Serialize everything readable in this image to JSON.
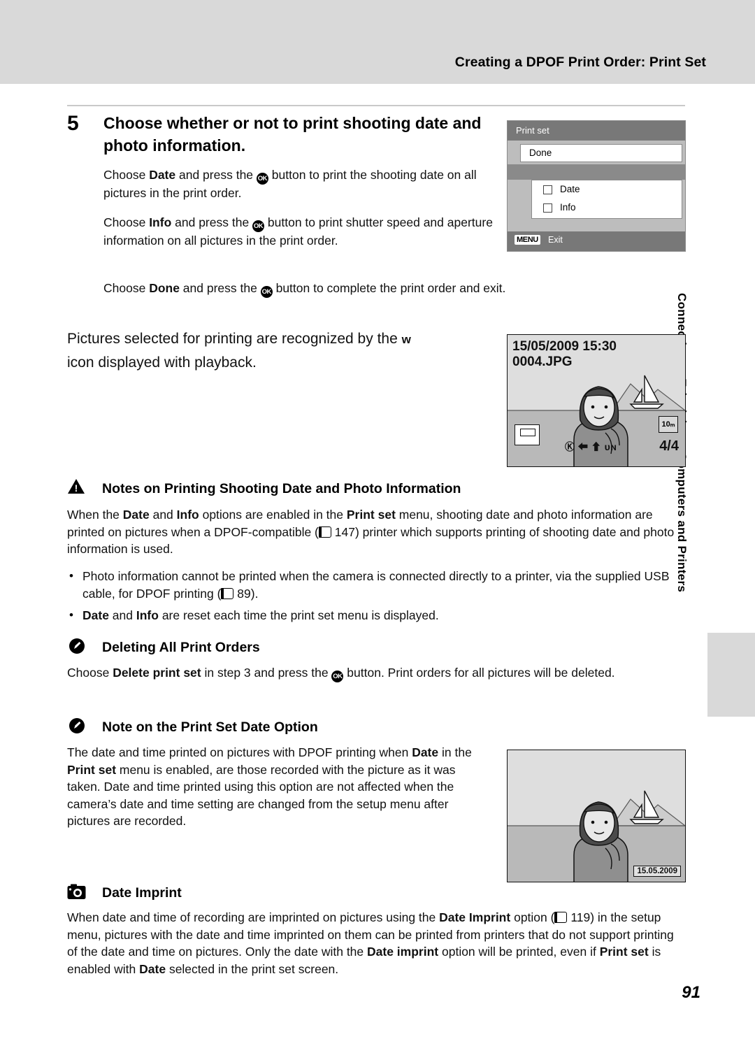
{
  "header": {
    "title": "Creating a DPOF Print Order: Print Set"
  },
  "side_tab": {
    "text": "Connecting to Televisions, Computers and Printers"
  },
  "step": {
    "number": "5",
    "heading": "Choose whether or not to print shooting date and photo information.",
    "p1_a": "Choose ",
    "p1_b": "Date",
    "p1_c": " and press the ",
    "p1_d": " button to print the shooting date on all pictures in the print order.",
    "p2_a": "Choose ",
    "p2_b": "Info",
    "p2_c": " and press the ",
    "p2_d": " button to print shutter speed and aperture information on all pictures in the print order.",
    "p3_a": "Choose ",
    "p3_b": "Done",
    "p3_c": " and press the ",
    "p3_d": " button to complete the print order and exit."
  },
  "recognize": {
    "line1": "Pictures selected for printing are recognized by the",
    "icon": "w",
    "line2": "icon displayed with playback."
  },
  "print_set_screen": {
    "title": "Print set",
    "done": "Done",
    "options": [
      "Date",
      "Info"
    ],
    "menu_badge": "MENU",
    "exit": "Exit"
  },
  "playback_screen": {
    "date": "15/05/2009 15:30",
    "file": "0004.JPG",
    "bottom_icons": "Ⓚ ⬅ ⬆ ᴜɴ",
    "frame_count": "4/",
    "frame_total": "4",
    "image_size": "10ₘ"
  },
  "notes_printing": {
    "title": "Notes on Printing Shooting Date and Photo Information",
    "p1_1": "When the ",
    "p1_2": "Date",
    "p1_3": " and ",
    "p1_4": "Info",
    "p1_5": " options are enabled in the ",
    "p1_6": "Print set",
    "p1_7": " menu, shooting date and photo information are printed on pictures when a DPOF-compatible (",
    "p1_ref": "147",
    "p1_8": ") printer which supports printing of shooting date and photo information is used.",
    "b1_1": "Photo information cannot be printed when the camera is connected directly to a printer, via the supplied USB cable, for DPOF printing (",
    "b1_ref": "89",
    "b1_2": ").",
    "b2_1": "Date",
    "b2_2": " and ",
    "b2_3": "Info",
    "b2_4": " are reset each time the print set menu is displayed."
  },
  "deleting": {
    "title": "Deleting All Print Orders",
    "p1": "Choose ",
    "p2": "Delete print set",
    "p3": " in step 3 and press the ",
    "p4": " button. Print orders for all pictures will be deleted."
  },
  "date_option": {
    "title": "Note on the Print Set Date Option",
    "l1": "The date and time printed on pictures with DPOF printing when",
    "l2a": "Date",
    "l2b": " in the ",
    "l2c": "Print set",
    "l2d": " menu is enabled, are those recorded with the",
    "l3": "picture as it was taken. Date and time printed using this option are",
    "l4": "not affected when the camera’s date and time setting are changed",
    "l5": "from the setup menu after pictures are recorded."
  },
  "bottom_photo": {
    "date": "15.05.2009"
  },
  "date_imprint": {
    "title": "Date Imprint",
    "t1": "When date and time of recording are imprinted on pictures using the ",
    "t2": "Date Imprint",
    "t3": " option (",
    "ref": "119",
    "t4": ") in the setup menu, pictures with the date and time imprinted on them can be printed from printers that do not support printing of the date and time on pictures. Only the date with the ",
    "t5": "Date imprint",
    "t6": " option will be printed, even if ",
    "t7": "Print set",
    "t8": " is enabled with ",
    "t9": "Date",
    "t10": " selected in the print set screen."
  },
  "page_number": "91"
}
